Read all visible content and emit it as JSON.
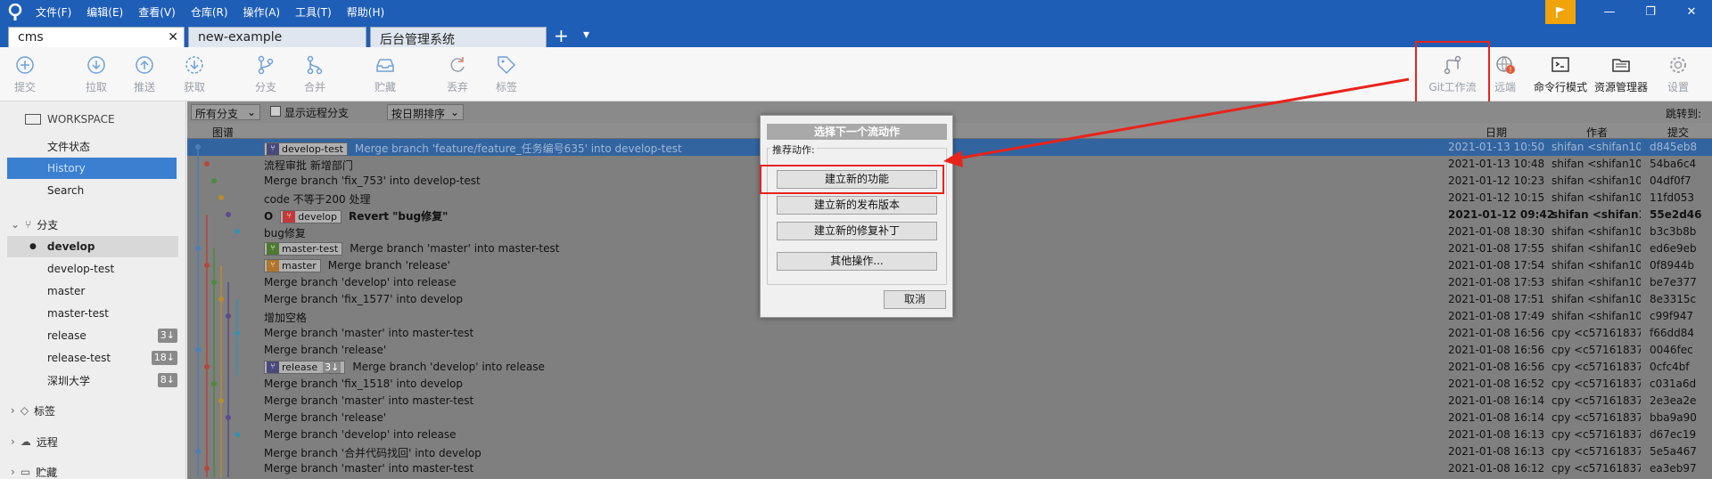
{
  "menu": [
    "文件(F)",
    "编辑(E)",
    "查看(V)",
    "仓库(R)",
    "操作(A)",
    "工具(T)",
    "帮助(H)"
  ],
  "tabs": [
    {
      "label": "cms",
      "close": "✕"
    },
    {
      "label": "new-example"
    },
    {
      "label": "后台管理系统"
    }
  ],
  "tab_add": "+",
  "tab_dropdown": "▾",
  "toolbar": {
    "commit": "提交",
    "pull": "拉取",
    "push": "推送",
    "fetch": "获取",
    "branch": "分支",
    "merge": "合并",
    "stash": "贮藏",
    "discard": "丢弃",
    "tag": "标签",
    "gitflow": "Git工作流",
    "remote": "远端",
    "terminal": "命令行模式",
    "explorer": "资源管理器",
    "settings": "设置"
  },
  "sidebar": {
    "workspace": "WORKSPACE",
    "file_status": "文件状态",
    "history": "History",
    "search": "Search",
    "branches_header": "分支",
    "branches": [
      {
        "name": "develop",
        "current": true
      },
      {
        "name": "develop-test"
      },
      {
        "name": "master"
      },
      {
        "name": "master-test"
      },
      {
        "name": "release",
        "badge": "3↓"
      },
      {
        "name": "release-test",
        "badge": "18↓"
      },
      {
        "name": "深圳大学",
        "badge": "8↓"
      }
    ],
    "tags_header": "标签",
    "remote_header": "远程",
    "stash_header": "贮藏"
  },
  "filter": {
    "branch_select": "所有分支",
    "show_remote": "显示远程分支",
    "sort": "按日期排序",
    "jump_to": "跳转到:"
  },
  "columns": {
    "graph": "图谱",
    "date": "日期",
    "author": "作者",
    "commit": "提交"
  },
  "commits": [
    {
      "tags": [
        {
          "label": "develop-test",
          "type": "blue"
        }
      ],
      "msg": "Merge branch 'feature/feature_任务编号635' into develop-test",
      "date": "2021-01-13 10:50",
      "author": "shifan <shifan10",
      "hash": "d845eb8",
      "selected": true
    },
    {
      "msg": "流程审批 新增部门",
      "date": "2021-01-13 10:48",
      "author": "shifan <shifan10",
      "hash": "54ba6c4"
    },
    {
      "msg": "Merge branch 'fix_753' into develop-test",
      "date": "2021-01-12 10:23",
      "author": "shifan <shifan10",
      "hash": "04df0f7"
    },
    {
      "msg": "code 不等于200 处理",
      "date": "2021-01-12 10:15",
      "author": "shifan <shifan10",
      "hash": "11fd053"
    },
    {
      "head": "O",
      "tags": [
        {
          "label": "develop",
          "type": "red"
        }
      ],
      "msg": "Revert \"bug修复\"",
      "date": "2021-01-12 09:42",
      "author": "shifan <shifan10",
      "hash": "55e2d46",
      "bold": true
    },
    {
      "msg": "bug修复",
      "date": "2021-01-08 18:30",
      "author": "shifan <shifan10",
      "hash": "b3c3b8b"
    },
    {
      "tags": [
        {
          "label": "master-test",
          "type": "green"
        }
      ],
      "msg": "Merge branch 'master' into master-test",
      "date": "2021-01-08 17:55",
      "author": "shifan <shifan10",
      "hash": "ed6e9eb"
    },
    {
      "tags": [
        {
          "label": "master",
          "type": "orange"
        }
      ],
      "msg": "Merge branch 'release'",
      "date": "2021-01-08 17:54",
      "author": "shifan <shifan10",
      "hash": "0f8944b"
    },
    {
      "msg": "Merge branch 'develop' into release",
      "date": "2021-01-08 17:53",
      "author": "shifan <shifan10",
      "hash": "be7e377"
    },
    {
      "msg": "Merge branch 'fix_1577' into develop",
      "date": "2021-01-08 17:51",
      "author": "shifan <shifan10",
      "hash": "8e3315c"
    },
    {
      "msg": "增加空格",
      "date": "2021-01-08 17:49",
      "author": "shifan <shifan10",
      "hash": "c99f947"
    },
    {
      "msg": "Merge branch 'master' into master-test",
      "date": "2021-01-08 16:56",
      "author": "cpy <c57161837",
      "hash": "f66dd84"
    },
    {
      "msg": "Merge branch 'release'",
      "date": "2021-01-08 16:56",
      "author": "cpy <c57161837",
      "hash": "0046fec"
    },
    {
      "tags": [
        {
          "label": "release",
          "type": "blue",
          "extra": "3↓"
        }
      ],
      "msg": "Merge branch 'develop' into release",
      "date": "2021-01-08 16:56",
      "author": "cpy <c57161837",
      "hash": "0cfc4bf"
    },
    {
      "msg": "Merge branch 'fix_1518' into develop",
      "date": "2021-01-08 16:52",
      "author": "cpy <c57161837",
      "hash": "c031a6d"
    },
    {
      "msg": "Merge branch 'master' into master-test",
      "date": "2021-01-08 16:14",
      "author": "cpy <c57161837",
      "hash": "2e3ea2e"
    },
    {
      "msg": "Merge branch 'release'",
      "date": "2021-01-08 16:14",
      "author": "cpy <c57161837",
      "hash": "bba9a90"
    },
    {
      "msg": "Merge branch 'develop' into release",
      "date": "2021-01-08 16:13",
      "author": "cpy <c57161837",
      "hash": "d67ec19"
    },
    {
      "msg": "Merge branch '合并代码找回' into develop",
      "date": "2021-01-08 16:13",
      "author": "cpy <c57161837",
      "hash": "5e5a467"
    },
    {
      "msg": "Merge branch 'master' into master-test",
      "date": "2021-01-08 16:12",
      "author": "cpy <c57161837",
      "hash": "ea3eb97"
    }
  ],
  "dialog": {
    "title": "选择下一个流动作",
    "section": "推荐动作:",
    "buttons": [
      "建立新的功能",
      "建立新的发布版本",
      "建立新的修复补丁",
      "其他操作..."
    ],
    "cancel": "取消"
  },
  "colors": {
    "titlebar": "#1e5eb7",
    "selection": "#3264a0",
    "highlight": "#e8231b",
    "flag": "#f0a30a"
  }
}
